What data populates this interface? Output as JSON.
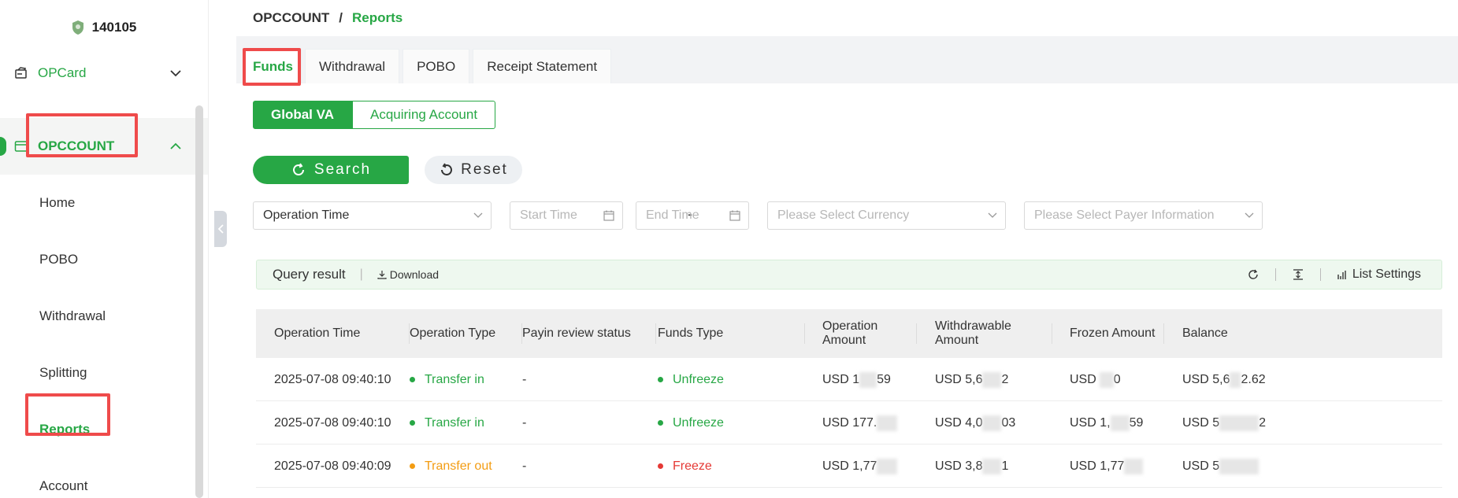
{
  "sidebar": {
    "user_id": "140105",
    "opcard_label": "OPCard",
    "opccount_label": "OPCCOUNT",
    "items": [
      {
        "label": "Home"
      },
      {
        "label": "POBO"
      },
      {
        "label": "Withdrawal"
      },
      {
        "label": "Splitting"
      },
      {
        "label": "Reports"
      },
      {
        "label": "Account"
      }
    ]
  },
  "breadcrumb": {
    "root": "OPCCOUNT",
    "separator": "/",
    "current": "Reports"
  },
  "tabs": [
    {
      "label": "Funds"
    },
    {
      "label": "Withdrawal"
    },
    {
      "label": "POBO"
    },
    {
      "label": "Receipt Statement"
    }
  ],
  "segment": {
    "option1": "Global VA",
    "option2": "Acquiring Account"
  },
  "actions": {
    "search": "Search",
    "reset": "Reset"
  },
  "filters": {
    "time_type": "Operation Time",
    "start_placeholder": "Start Time",
    "end_placeholder": "End Time",
    "range_sep": "-",
    "currency_placeholder": "Please Select Currency",
    "payer_placeholder": "Please Select Payer Information"
  },
  "query": {
    "title": "Query result",
    "bar": "|",
    "download": "Download",
    "list_settings": "List Settings"
  },
  "table": {
    "headers": [
      "Operation Time",
      "Operation Type",
      "Payin review status",
      "Funds Type",
      "Operation Amount",
      "Withdrawable Amount",
      "Frozen Amount",
      "Balance"
    ],
    "rows": [
      {
        "time": "2025-07-08 09:40:10",
        "op_type": "Transfer in",
        "review": "-",
        "funds_type": "Unfreeze",
        "op_amount_a": "USD 1",
        "op_amount_b": "59",
        "withdrawable_a": "USD 5,6",
        "withdrawable_b": "2",
        "frozen_a": "USD",
        "frozen_b": "0",
        "balance_a": "USD 5,6",
        "balance_b": "2.62"
      },
      {
        "time": "2025-07-08 09:40:10",
        "op_type": "Transfer in",
        "review": "-",
        "funds_type": "Unfreeze",
        "op_amount_a": "USD 177.",
        "op_amount_b": "",
        "withdrawable_a": "USD 4,0",
        "withdrawable_b": "03",
        "frozen_a": "USD 1,",
        "frozen_b": "59",
        "balance_a": "USD 5",
        "balance_b": "2"
      },
      {
        "time": "2025-07-08 09:40:09",
        "op_type": "Transfer out",
        "review": "-",
        "funds_type": "Freeze",
        "op_amount_a": "USD 1,77",
        "op_amount_b": "",
        "withdrawable_a": "USD 3,8",
        "withdrawable_b": "1",
        "frozen_a": "USD 1,77",
        "frozen_b": "",
        "balance_a": "USD 5",
        "balance_b": ""
      }
    ]
  },
  "colors": {
    "brand_green": "#27a745",
    "highlight_red": "#ef4b4b",
    "warn_orange": "#f39c12",
    "danger_red": "#e53935"
  }
}
